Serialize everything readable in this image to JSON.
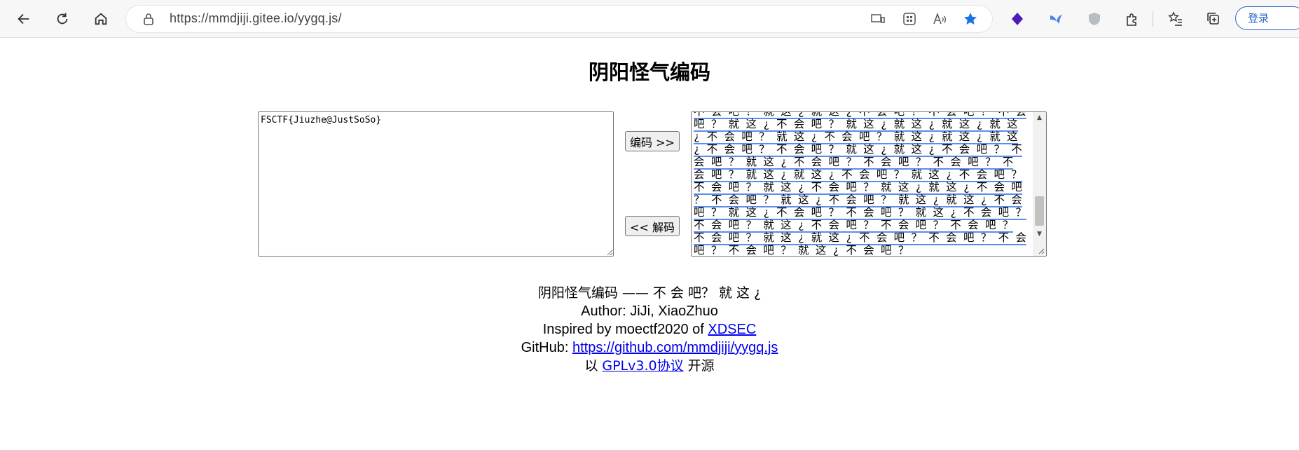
{
  "browser": {
    "url": "https://mmdjiji.gitee.io/yygq.js/",
    "login_label": "登录",
    "icons": {
      "back": "back-arrow-icon",
      "refresh": "refresh-icon",
      "home": "home-icon",
      "lock": "lock-icon",
      "cast": "cast-icon",
      "apps": "apps-grid-icon",
      "read_aloud": "read-aloud-icon",
      "favorite": "star-filled-icon",
      "ext1": "purple-diamond-extension-icon",
      "ext2": "blue-bird-extension-icon",
      "ext3": "grey-shield-extension-icon",
      "extensions": "puzzle-icon",
      "favorites": "favorites-list-icon",
      "collections": "collections-icon"
    },
    "accent_color": "#1a73e8"
  },
  "page": {
    "title": "阴阳怪气编码",
    "input_text": "FSCTF{Jiuzhe@JustSoSo}",
    "encode_button": "编码 >>",
    "decode_button": "<< 解码",
    "output_text": "不 会 吧 ？ 就 这 ¿ 就 这 ¿ 不 会 吧 ？ 不 会 吧 ？ 不 会 吧 ？ 就 这 ¿ 不 会 吧 ？ 就 这 ¿ 就 这 ¿ 就 这 ¿ 就 这 ¿ 不 会 吧 ？ 就 这 ¿ 不 会 吧 ？ 就 这 ¿ 就 这 ¿ 就 这 ¿ 不 会 吧 ？ 不 会 吧 ？ 就 这 ¿ 就 这 ¿ 不 会 吧 ？ 不 会 吧 ？ 就 这 ¿ 不 会 吧 ？ 不 会 吧 ？ 不 会 吧 ？ 不 会 吧 ？ 就 这 ¿ 就 这 ¿ 不 会 吧 ？ 就 这 ¿ 不 会 吧 ？ 不 会 吧 ？ 就 这 ¿ 不 会 吧 ？ 就 这 ¿ 就 这 ¿ 不 会 吧 ？ 不 会 吧 ？ 就 这 ¿ 不 会 吧 ？ 就 这 ¿ 就 这 ¿ 不 会 吧 ？ 就 这 ¿ 不 会 吧 ？ 不 会 吧 ？ 就 这 ¿ 不 会 吧 ？ 不 会 吧 ？ 就 这 ¿ 不 会 吧 ？ 不 会 吧 ？ 不 会 吧 ？ 不 会 吧 ？ 就 这 ¿ 就 这 ¿ 不 会 吧 ？ 不 会 吧 ？ 不 会 吧 ？ 不 会 吧 ？ 就 这 ¿ 不 会 吧 ？"
  },
  "footer": {
    "line1": "阴阳怪气编码 —— 不 会 吧？ 就 这 ¿",
    "line2": "Author: JiJi, XiaoZhuo",
    "line3_prefix": "Inspired by moectf2020 of ",
    "line3_link": "XDSEC",
    "line4_prefix": "GitHub: ",
    "line4_link": "https://github.com/mmdjiji/yygq.js",
    "line5_prefix": "以 ",
    "line5_link": "GPLv3.0协议",
    "line5_suffix": " 开源"
  }
}
